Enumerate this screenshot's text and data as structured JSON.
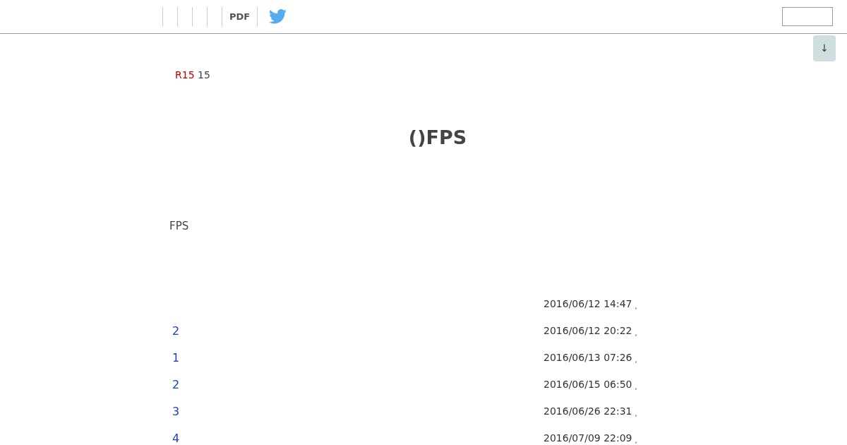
{
  "nav": {
    "items": [
      {
        "kind": "blank"
      },
      {
        "kind": "blank"
      },
      {
        "kind": "blank"
      },
      {
        "kind": "blank"
      },
      {
        "kind": "text",
        "label": "PDF"
      },
      {
        "kind": "twitter"
      }
    ]
  },
  "scroll_button": {
    "label": "↓"
  },
  "rating": {
    "code": "R15",
    "text": "15"
  },
  "title": "()FPS",
  "intro": "FPS",
  "comments": [
    {
      "time": "2016/06/12 14:47",
      "suffix": ","
    },
    {
      "number": "2",
      "time": "2016/06/12 20:22",
      "suffix": ","
    },
    {
      "number": "1",
      "time": "2016/06/13 07:26",
      "suffix": ","
    },
    {
      "number": "2",
      "time": "2016/06/15 06:50",
      "suffix": ","
    },
    {
      "number": "3",
      "time": "2016/06/26 22:31",
      "suffix": ","
    },
    {
      "number": "4",
      "time": "2016/07/09 22:09",
      "suffix": ","
    }
  ]
}
